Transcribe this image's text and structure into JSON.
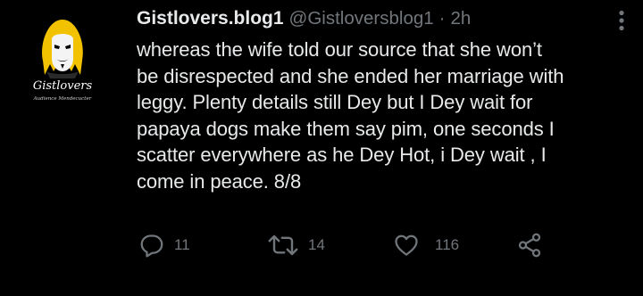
{
  "tweet": {
    "display_name": "Gistlovers.blog1",
    "handle": "@Gistloversblog1",
    "separator": "·",
    "time": "2h",
    "avatar_text": "Gistlovers",
    "avatar_subtext": "Audience Mendecucter",
    "lines": [
      "whereas the wife told our source that she won’t",
      "be disrespected and she ended her marriage with",
      "leggy. Plenty details still Dey but I Dey wait for",
      "papaya dogs make them say pim, one seconds I",
      "scatter everywhere as he Dey Hot, i Dey wait , I",
      "come in peace. 8/8"
    ]
  },
  "actions": {
    "replies": "11",
    "retweets": "14",
    "likes": "116"
  },
  "icons": {
    "reply": "comment-bubble-icon",
    "retweet": "retweet-arrows-icon",
    "like": "heart-icon",
    "share": "share-nodes-icon",
    "more": "more-dots-icon"
  },
  "colors": {
    "background": "#000000",
    "text": "#e7e9ea",
    "muted": "#71767b",
    "avatar_accent": "#f2c200"
  }
}
